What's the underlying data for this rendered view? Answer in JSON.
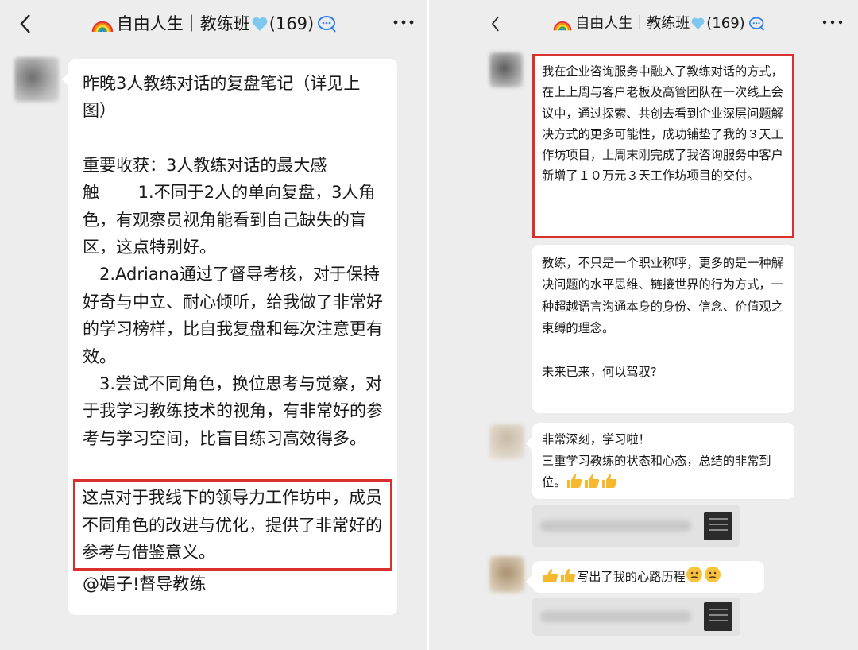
{
  "left": {
    "title": "自由人生｜教练班",
    "count": "(169)",
    "message": {
      "heading": "昨晚3人教练对话的复盘笔记（详见上图）",
      "takeaway_title": "重要收获：3人教练对话的最大感",
      "item1": "触　　 1.不同于2人的单向复盘，3人角色，有观察员视角能看到自己缺失的盲区，这点特别好。",
      "item2": "　2.Adriana通过了督导考核，对于保持好奇与中立、耐心倾听，给我做了非常好的学习榜样，比自我复盘和每次注意更有效。",
      "item3": "　3.尝试不同角色，换位思考与觉察，对于我学习教练技术的视角，有非常好的参考与学习空间，比盲目练习高效得多。",
      "highlight": "这点对于我线下的领导力工作坊中，成员不同角色的改进与优化，提供了非常好的参考与借鉴意义。",
      "mention": "@娟子!督导教练"
    }
  },
  "right": {
    "title": "自由人生｜教练班",
    "count": "(169)",
    "msg1": "我在企业咨询服务中融入了教练对话的方式，在上上周与客户老板及高管团队在一次线上会议中，通过探索、共创去看到企业深层问题解决方式的更多可能性，成功铺垫了我的３天工作坊项目，上周末刚完成了我咨询服务中客户新增了１０万元３天工作坊项目的交付。",
    "msg2": "教练，不只是一个职业称呼，更多的是一种解决问题的水平思维、链接世界的行为方式，一种超越语言沟通本身的身份、信念、价值观之束缚的理念。",
    "msg2b": "未来已来，何以驾驭?",
    "msg3a": "非常深刻，学习啦！",
    "msg3b": "三重学习教练的状态和心态，总结的非常到位。",
    "msg4": "写出了我的心路历程"
  },
  "colors": {
    "highlight_border": "#d9302c",
    "bubble": "#ffffff",
    "background": "#ededed"
  },
  "icons": [
    "back-arrow-icon",
    "rainbow-icon",
    "heart-icon",
    "chat-bubble-icon",
    "more-icon",
    "thumbs-up-icon",
    "thinking-face-icon"
  ]
}
